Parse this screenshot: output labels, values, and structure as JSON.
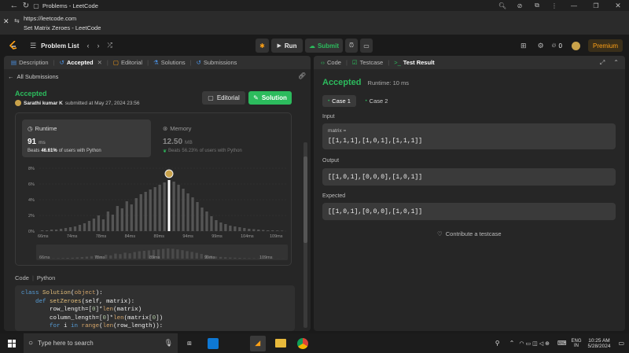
{
  "browser": {
    "tab_title": "Problems - LeetCode",
    "url": "https://leetcode.com",
    "page_title": "Set Matrix Zeroes - LeetCode"
  },
  "app": {
    "problem_list": "Problem List",
    "run": "Run",
    "submit": "Submit",
    "streak": "0",
    "premium": "Premium"
  },
  "left_tabs": {
    "description": "Description",
    "accepted": "Accepted",
    "editorial": "Editorial",
    "solutions": "Solutions",
    "submissions": "Submissions"
  },
  "submission": {
    "back": "All Submissions",
    "status": "Accepted",
    "user": "Sarathi kumar K",
    "submitted": "submitted at May 27, 2024 23:56",
    "editorial_btn": "Editorial",
    "solution_btn": "Solution",
    "runtime_label": "Runtime",
    "runtime_value": "91",
    "runtime_unit": "ms",
    "runtime_beats_prefix": "Beats",
    "runtime_beats": "46.61%",
    "runtime_beats_suffix": "of users with Python",
    "memory_label": "Memory",
    "memory_value": "12.50",
    "memory_unit": "MB",
    "memory_beats_prefix": "Beats",
    "memory_beats": "56.23%",
    "memory_beats_suffix": "of users with Python"
  },
  "chart_data": {
    "type": "bar",
    "y_ticks": [
      "8%",
      "6%",
      "4%",
      "2%",
      "0%"
    ],
    "ylim": [
      0,
      8
    ],
    "x_ticks": [
      "66ms",
      "74ms",
      "78ms",
      "84ms",
      "89ms",
      "94ms",
      "99ms",
      "104ms",
      "109ms"
    ],
    "values": [
      0.1,
      0.1,
      0.2,
      0.2,
      0.3,
      0.4,
      0.5,
      0.6,
      0.8,
      1.0,
      1.3,
      1.6,
      2.0,
      1.5,
      2.5,
      2.1,
      3.2,
      2.9,
      3.8,
      3.4,
      4.2,
      4.7,
      5.0,
      5.3,
      5.6,
      5.9,
      6.2,
      6.5,
      6.3,
      5.9,
      5.4,
      4.8,
      4.3,
      3.7,
      3.0,
      2.5,
      1.9,
      1.4,
      1.1,
      0.9,
      0.7,
      0.6,
      0.5,
      0.4,
      0.3,
      0.25,
      0.2,
      0.15,
      0.1,
      0.1,
      0.08,
      0.06
    ],
    "highlight_index": 27,
    "mini_ticks": [
      "66ms",
      "78ms",
      "89ms",
      "99ms",
      "109ms"
    ]
  },
  "code": {
    "label": "Code",
    "language": "Python",
    "lines": [
      "class Solution(object):",
      "    def setZeroes(self, matrix):",
      "        row_length=[0]*len(matrix)",
      "        column_length=[0]*len(matrix[0])",
      "        for i in range(len(row_length)):"
    ]
  },
  "right_tabs": {
    "code": "Code",
    "testcase": "Testcase",
    "result": "Test Result"
  },
  "result": {
    "status": "Accepted",
    "runtime": "Runtime: 10 ms",
    "case1": "Case 1",
    "case2": "Case 2",
    "input_label": "Input",
    "input_var": "matrix =",
    "input_value": "[[1,1,1],[1,0,1],[1,1,1]]",
    "output_label": "Output",
    "output_value": "[[1,0,1],[0,0,0],[1,0,1]]",
    "expected_label": "Expected",
    "expected_value": "[[1,0,1],[0,0,0],[1,0,1]]",
    "contribute": "Contribute a testcase"
  },
  "taskbar": {
    "search_placeholder": "Type here to search",
    "lang": "ENG",
    "region": "IN",
    "time": "10:25 AM",
    "date": "5/28/2024"
  },
  "colors": {
    "accent_green": "#2cbb5d",
    "leet_orange": "#ffa116"
  }
}
